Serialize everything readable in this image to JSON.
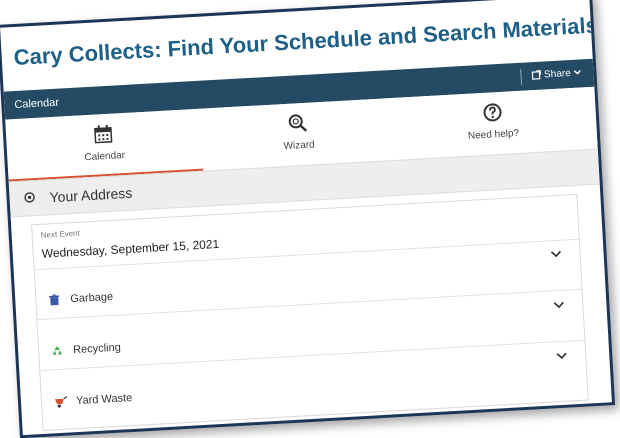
{
  "page": {
    "title": "Cary Collects: Find Your Schedule and Search Materials"
  },
  "header": {
    "section_label": "Calendar",
    "share_label": "Share"
  },
  "tabs": [
    {
      "label": "Calendar",
      "icon": "calendar-icon",
      "active": true
    },
    {
      "label": "Wizard",
      "icon": "wizard-search-icon",
      "active": false
    },
    {
      "label": "Need help?",
      "icon": "help-icon",
      "active": false
    }
  ],
  "address": {
    "label": "Your Address"
  },
  "next_event": {
    "label": "Next Event",
    "date": "Wednesday, September 15, 2021",
    "items": [
      {
        "label": "Garbage",
        "icon": "trash-can-icon",
        "color": "#3b5ba5"
      },
      {
        "label": "Recycling",
        "icon": "recycle-icon",
        "color": "#4caf50"
      },
      {
        "label": "Yard Waste",
        "icon": "wheelbarrow-icon",
        "color": "#d9502e"
      }
    ]
  },
  "colors": {
    "accent": "#d9502e",
    "header_bar": "#244b63",
    "title": "#1d5f86"
  }
}
